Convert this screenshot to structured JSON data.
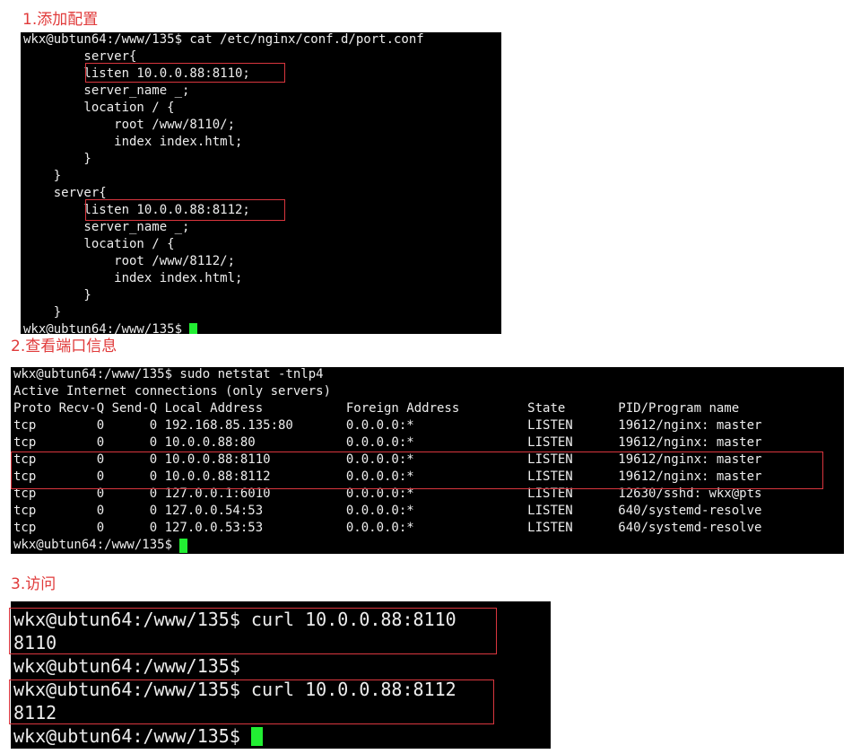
{
  "headings": {
    "step1": "1.添加配置",
    "step2": "2.查看端口信息",
    "step3": "3.访问"
  },
  "colors": {
    "heading": "#e03a3a",
    "highlight_box": "#d9363e",
    "terminal_bg": "#000000",
    "terminal_fg": "#ededed",
    "cursor": "#22ee33"
  },
  "terminal_config": {
    "lines": [
      "wkx@ubtun64:/www/135$ cat /etc/nginx/conf.d/port.conf",
      "        server{",
      "        listen 10.0.0.88:8110;",
      "        server_name _;",
      "        location / {",
      "            root /www/8110/;",
      "            index index.html;",
      "        }",
      "    }",
      "    server{",
      "        listen 10.0.0.88:8112;",
      "        server_name _;",
      "        location / {",
      "            root /www/8112/;",
      "            index index.html;",
      "        }",
      "    }"
    ],
    "prompt": "wkx@ubtun64:/www/135$ "
  },
  "terminal_netstat": {
    "lines": [
      "wkx@ubtun64:/www/135$ sudo netstat -tnlp4",
      "Active Internet connections (only servers)",
      "Proto Recv-Q Send-Q Local Address           Foreign Address         State       PID/Program name",
      "tcp        0      0 192.168.85.135:80       0.0.0.0:*               LISTEN      19612/nginx: master",
      "tcp        0      0 10.0.0.88:80            0.0.0.0:*               LISTEN      19612/nginx: master",
      "tcp        0      0 10.0.0.88:8110          0.0.0.0:*               LISTEN      19612/nginx: master",
      "tcp        0      0 10.0.0.88:8112          0.0.0.0:*               LISTEN      19612/nginx: master",
      "tcp        0      0 127.0.0.1:6010          0.0.0.0:*               LISTEN      12630/sshd: wkx@pts",
      "tcp        0      0 127.0.0.54:53           0.0.0.0:*               LISTEN      640/systemd-resolve",
      "tcp        0      0 127.0.0.53:53           0.0.0.0:*               LISTEN      640/systemd-resolve"
    ],
    "prompt": "wkx@ubtun64:/www/135$ "
  },
  "terminal_curl": {
    "lines": [
      "wkx@ubtun64:/www/135$ curl 10.0.0.88:8110",
      "8110",
      "wkx@ubtun64:/www/135$",
      "wkx@ubtun64:/www/135$ curl 10.0.0.88:8112",
      "8112"
    ],
    "prompt": "wkx@ubtun64:/www/135$ "
  }
}
